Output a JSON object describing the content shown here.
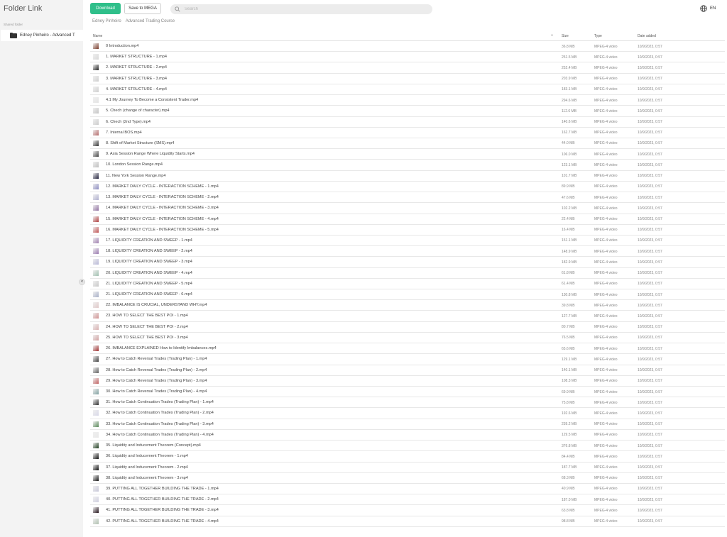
{
  "sidebar": {
    "title": "Folder Link",
    "section": "Shared folder",
    "folder_label": "Edney Pinheiro - Advanced T",
    "collapse_glyph": "«"
  },
  "toolbar": {
    "download_label": "Download",
    "save_label": "Save to MEGA",
    "search_placeholder": "Search",
    "lang_label": "EN"
  },
  "breadcrumb": [
    "Edney Pinheiro",
    "Advanced Trading Course"
  ],
  "columns": {
    "name": "Name",
    "size": "Size",
    "type": "Type",
    "date": "Date added"
  },
  "colors": {
    "accent": "#2fbf8a",
    "sidebar_bg": "#f3f3f3"
  },
  "files": [
    {
      "name": "0 Introduction.mp4",
      "size": "36.8 MB",
      "type": "MPEG-4 video",
      "date": "10/9/2023, 0:57",
      "thumb": "#7a3b2a"
    },
    {
      "name": "1. MARKET STRUCTURE - 1.mp4",
      "size": "251.5 MB",
      "type": "MPEG-4 video",
      "date": "10/9/2023, 0:57",
      "thumb": "#d8d8d8"
    },
    {
      "name": "2. MARKET STRUCTURE - 2.mp4",
      "size": "252.4 MB",
      "type": "MPEG-4 video",
      "date": "10/9/2023, 0:57",
      "thumb": "#222222"
    },
    {
      "name": "3. MARKET STRUCTURE - 3.mp4",
      "size": "203.9 MB",
      "type": "MPEG-4 video",
      "date": "10/9/2023, 0:57",
      "thumb": "#cfcfcf"
    },
    {
      "name": "4. MARKET STRUCTURE - 4.mp4",
      "size": "183.1 MB",
      "type": "MPEG-4 video",
      "date": "10/9/2023, 0:57",
      "thumb": "#d0d0d0"
    },
    {
      "name": "4.1 My Journey To Become a Consistent Trader.mp4",
      "size": "294.6 MB",
      "type": "MPEG-4 video",
      "date": "10/9/2023, 0:57",
      "thumb": "#e4e4e4"
    },
    {
      "name": "5. Chech (change of character).mp4",
      "size": "112.6 MB",
      "type": "MPEG-4 video",
      "date": "10/9/2023, 0:57",
      "thumb": "#c4c4c4"
    },
    {
      "name": "6. Chech (2nd Type).mp4",
      "size": "140.6 MB",
      "type": "MPEG-4 video",
      "date": "10/9/2023, 0:57",
      "thumb": "#cccccc"
    },
    {
      "name": "7. Internal BOS.mp4",
      "size": "162.7 MB",
      "type": "MPEG-4 video",
      "date": "10/9/2023, 0:57",
      "thumb": "#b56a6a"
    },
    {
      "name": "8. Shift of Market Structure (SMS).mp4",
      "size": "44.0 MB",
      "type": "MPEG-4 video",
      "date": "10/9/2023, 0:57",
      "thumb": "#333333"
    },
    {
      "name": "9. Asia Session Range Where Liquidity Starts.mp4",
      "size": "106.0 MB",
      "type": "MPEG-4 video",
      "date": "10/9/2023, 0:57",
      "thumb": "#444444"
    },
    {
      "name": "10. London Session Range.mp4",
      "size": "123.1 MB",
      "type": "MPEG-4 video",
      "date": "10/9/2023, 0:57",
      "thumb": "#bfbfbf"
    },
    {
      "name": "11. New York Session Range.mp4",
      "size": "101.7 MB",
      "type": "MPEG-4 video",
      "date": "10/9/2023, 0:57",
      "thumb": "#1e1e3a"
    },
    {
      "name": "12. MARKET DAILY CYCLE - INTERACTION SCHEME - 1.mp4",
      "size": "89.9 MB",
      "type": "MPEG-4 video",
      "date": "10/9/2023, 0:57",
      "thumb": "#8a8ac0"
    },
    {
      "name": "13. MARKET DAILY CYCLE - INTERACTION SCHEME - 2.mp4",
      "size": "47.6 MB",
      "type": "MPEG-4 video",
      "date": "10/9/2023, 0:57",
      "thumb": "#b0b0d0"
    },
    {
      "name": "14. MARKET DAILY CYCLE - INTERACTION SCHEME - 3.mp4",
      "size": "102.2 MB",
      "type": "MPEG-4 video",
      "date": "10/9/2023, 0:57",
      "thumb": "#9070a0"
    },
    {
      "name": "15. MARKET DAILY CYCLE - INTERACTION SCHEME - 4.mp4",
      "size": "22.4 MB",
      "type": "MPEG-4 video",
      "date": "10/9/2023, 0:57",
      "thumb": "#b04040"
    },
    {
      "name": "16. MARKET DAILY CYCLE - INTERACTION SCHEME - 5.mp4",
      "size": "16.4 MB",
      "type": "MPEG-4 video",
      "date": "10/9/2023, 0:57",
      "thumb": "#c05050"
    },
    {
      "name": "17. LIQUIDITY CREATION AND SWEEP - 1.mp4",
      "size": "151.1 MB",
      "type": "MPEG-4 video",
      "date": "10/9/2023, 0:57",
      "thumb": "#a080b0"
    },
    {
      "name": "18. LIQUIDITY CREATION AND SWEEP - 2.mp4",
      "size": "148.9 MB",
      "type": "MPEG-4 video",
      "date": "10/9/2023, 0:57",
      "thumb": "#9a7ab0"
    },
    {
      "name": "19. LIQUIDITY CREATION AND SWEEP - 3.mp4",
      "size": "182.9 MB",
      "type": "MPEG-4 video",
      "date": "10/9/2023, 0:57",
      "thumb": "#b8b8d8"
    },
    {
      "name": "20. LIQUIDITY CREATION AND SWEEP - 4.mp4",
      "size": "61.8 MB",
      "type": "MPEG-4 video",
      "date": "10/9/2023, 0:57",
      "thumb": "#a0c0b0"
    },
    {
      "name": "21. LIQUIDITY CREATION AND SWEEP - 5.mp4",
      "size": "61.4 MB",
      "type": "MPEG-4 video",
      "date": "10/9/2023, 0:57",
      "thumb": "#c8c8c8"
    },
    {
      "name": "21. LIQUIDITY CREATION AND SWEEP - 6.mp4",
      "size": "130.8 MB",
      "type": "MPEG-4 video",
      "date": "10/9/2023, 0:57",
      "thumb": "#a8b0c8"
    },
    {
      "name": "22. IMBALANCE IS CRUCIAL, UNDERSTAND WHY.mp4",
      "size": "39.8 MB",
      "type": "MPEG-4 video",
      "date": "10/9/2023, 0:57",
      "thumb": "#e0c8c8"
    },
    {
      "name": "23. HOW TO SELECT THE BEST POI - 1.mp4",
      "size": "127.7 MB",
      "type": "MPEG-4 video",
      "date": "10/9/2023, 0:57",
      "thumb": "#d09090"
    },
    {
      "name": "24. HOW TO SELECT THE BEST POI - 2.mp4",
      "size": "80.7 MB",
      "type": "MPEG-4 video",
      "date": "10/9/2023, 0:57",
      "thumb": "#d8b0b0"
    },
    {
      "name": "25. HOW TO SELECT THE BEST POI - 3.mp4",
      "size": "76.5 MB",
      "type": "MPEG-4 video",
      "date": "10/9/2023, 0:57",
      "thumb": "#d0a0a0"
    },
    {
      "name": "26. IMBALANCE EXPLAINED How to Identify Imbalances.mp4",
      "size": "65.6 MB",
      "type": "MPEG-4 video",
      "date": "10/9/2023, 0:57",
      "thumb": "#a03030"
    },
    {
      "name": "27. How to Catch Reversal Trades (Trading Plan) - 1.mp4",
      "size": "129.1 MB",
      "type": "MPEG-4 video",
      "date": "10/9/2023, 0:57",
      "thumb": "#404040"
    },
    {
      "name": "28. How to Catch Reversal Trades (Trading Plan) - 2.mp4",
      "size": "140.1 MB",
      "type": "MPEG-4 video",
      "date": "10/9/2023, 0:57",
      "thumb": "#606060"
    },
    {
      "name": "29. How to Catch Reversal Trades (Trading Plan) - 3.mp4",
      "size": "108.3 MB",
      "type": "MPEG-4 video",
      "date": "10/9/2023, 0:57",
      "thumb": "#c06060"
    },
    {
      "name": "30. How to Catch Reversal Trades (Trading Plan) - 4.mp4",
      "size": "69.9 MB",
      "type": "MPEG-4 video",
      "date": "10/9/2023, 0:57",
      "thumb": "#80a0a0"
    },
    {
      "name": "31. How to Catch Continuation Trades (Trading Plan) - 1.mp4",
      "size": "75.8 MB",
      "type": "MPEG-4 video",
      "date": "10/9/2023, 0:57",
      "thumb": "#303030"
    },
    {
      "name": "32. How to Catch Continuation Trades (Trading Plan) - 2.mp4",
      "size": "192.6 MB",
      "type": "MPEG-4 video",
      "date": "10/9/2023, 0:57",
      "thumb": "#d8d8e8"
    },
    {
      "name": "33. How to Catch Continuation Trades (Trading Plan) - 3.mp4",
      "size": "239.2 MB",
      "type": "MPEG-4 video",
      "date": "10/9/2023, 0:57",
      "thumb": "#5a8a5a"
    },
    {
      "name": "34. How to Catch Continuation Trades (Trading Plan) - 4.mp4",
      "size": "129.5 MB",
      "type": "MPEG-4 video",
      "date": "10/9/2023, 0:57",
      "thumb": "#e8e8e8"
    },
    {
      "name": "35. Liquidity and Inducement Theorem (Concept).mp4",
      "size": "376.8 MB",
      "type": "MPEG-4 video",
      "date": "10/9/2023, 0:57",
      "thumb": "#1a3a1a"
    },
    {
      "name": "36. Liquidity and Inducement Theorem - 1.mp4",
      "size": "84.4 MB",
      "type": "MPEG-4 video",
      "date": "10/9/2023, 0:57",
      "thumb": "#101010"
    },
    {
      "name": "37. Liquidity and Inducement Theorem - 2.mp4",
      "size": "187.7 MB",
      "type": "MPEG-4 video",
      "date": "10/9/2023, 0:57",
      "thumb": "#0a0a0a"
    },
    {
      "name": "38. Liquidity and Inducement Theorem - 3.mp4",
      "size": "68.3 MB",
      "type": "MPEG-4 video",
      "date": "10/9/2023, 0:57",
      "thumb": "#151515"
    },
    {
      "name": "39. PUTTING ALL TOGETHER BUILDING THE TRADE - 1.mp4",
      "size": "40.9 MB",
      "type": "MPEG-4 video",
      "date": "10/9/2023, 0:57",
      "thumb": "#c8c8d8"
    },
    {
      "name": "40. PUTTING ALL TOGETHER BUILDING THE TRADE - 2.mp4",
      "size": "187.0 MB",
      "type": "MPEG-4 video",
      "date": "10/9/2023, 0:57",
      "thumb": "#d0d0e0"
    },
    {
      "name": "41. PUTTING ALL TOGETHER BUILDING THE TRADE - 3.mp4",
      "size": "63.8 MB",
      "type": "MPEG-4 video",
      "date": "10/9/2023, 0:57",
      "thumb": "#201018"
    },
    {
      "name": "42. PUTTING ALL TOGETHER BUILDING THE TRADE - 4.mp4",
      "size": "98.8 MB",
      "type": "MPEG-4 video",
      "date": "10/9/2023, 0:57",
      "thumb": "#b0c0b0"
    }
  ]
}
